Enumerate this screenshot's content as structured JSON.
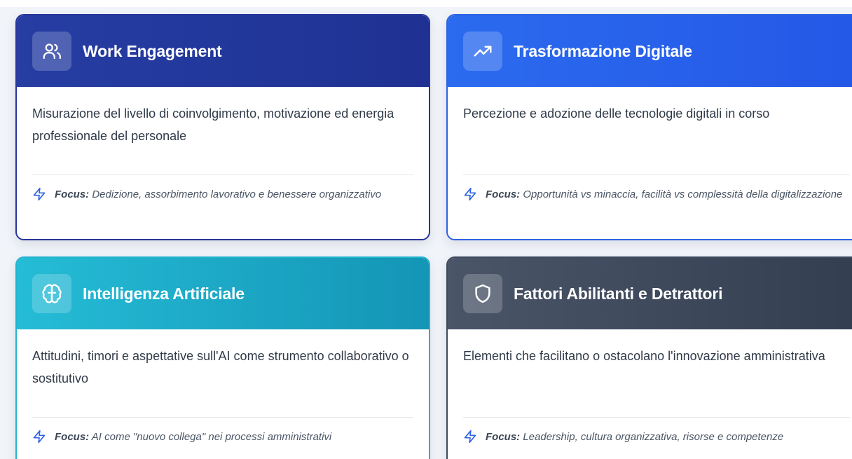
{
  "cards": [
    {
      "title": "Work Engagement",
      "icon": "users-icon",
      "description": "Misurazione del livello di coinvolgimento, motivazione ed energia professionale del personale",
      "focus_label": "Focus:",
      "focus_text": " Dedizione, assorbimento lavorativo e benessere organizzativo",
      "accent": "#263da3"
    },
    {
      "title": "Trasformazione Digitale",
      "icon": "trending-up-icon",
      "description": "Percezione e adozione delle tecnologie digitali in corso",
      "focus_label": "Focus:",
      "focus_text": " Opportunità vs minaccia, facilità vs complessità della digitalizzazione",
      "accent": "#2b6bef"
    },
    {
      "title": "Intelligenza Artificiale",
      "icon": "brain-icon",
      "description": "Attitudini, timori e aspettative sull'AI come strumento collaborativo o sostitutivo",
      "focus_label": "Focus:",
      "focus_text": " AI come \"nuovo collega\" nei processi amministrativi",
      "accent": "#1ba8c6"
    },
    {
      "title": "Fattori Abilitanti e Detrattori",
      "icon": "shield-icon",
      "description": "Elementi che facilitano o ostacolano l'innovazione amministrativa",
      "focus_label": "Focus:",
      "focus_text": " Leadership, cultura organizzativa, risorse e competenze",
      "accent": "#3e4a5e"
    }
  ],
  "focus_icon": "lightning-bolt-icon",
  "focus_icon_color": "#2f63e3"
}
